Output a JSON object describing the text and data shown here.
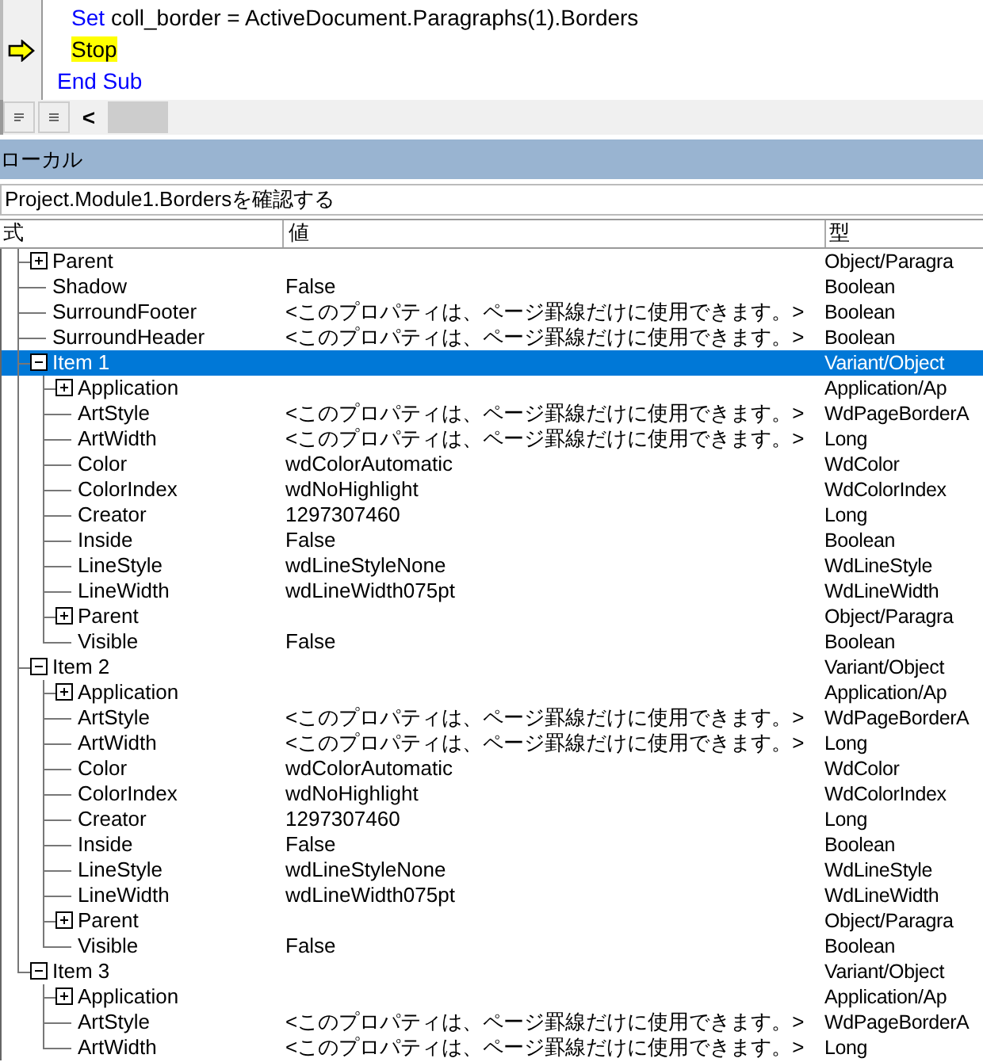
{
  "code": {
    "body_lines": [
      {
        "current": false,
        "tokens": [
          {
            "kind": "keyword",
            "text": "Set"
          },
          {
            "kind": "plain",
            "text": "coll_border = ActiveDocument.Paragraphs(1).Borders"
          }
        ]
      },
      {
        "current": true,
        "tokens": [
          {
            "kind": "plain",
            "text": "Stop"
          }
        ]
      }
    ],
    "end_line": {
      "current": false,
      "tokens": [
        {
          "kind": "keyword",
          "text": "End Sub"
        }
      ]
    }
  },
  "scroll_left": "<",
  "panel": {
    "title": "ローカル",
    "context": "Project.Module1.Bordersを確認する"
  },
  "columns": [
    "式",
    "値",
    "型"
  ],
  "tree": [
    {
      "name": "Parent",
      "type": "Object/Paragra",
      "expanded": false,
      "selected": false
    },
    {
      "name": "Shadow",
      "value": "False",
      "type": "Boolean",
      "selected": false
    },
    {
      "name": "SurroundFooter",
      "value": "<このプロパティは、ページ罫線だけに使用できます。>",
      "type": "Boolean",
      "selected": false
    },
    {
      "name": "SurroundHeader",
      "value": "<このプロパティは、ページ罫線だけに使用できます。>",
      "type": "Boolean",
      "selected": false
    },
    {
      "name": "Item 1",
      "type": "Variant/Object",
      "expanded": true,
      "selected": true,
      "children": [
        {
          "name": "Application",
          "type": "Application/Ap",
          "expanded": false,
          "selected": false
        },
        {
          "name": "ArtStyle",
          "value": "<このプロパティは、ページ罫線だけに使用できます。>",
          "type": "WdPageBorderA",
          "selected": false
        },
        {
          "name": "ArtWidth",
          "value": "<このプロパティは、ページ罫線だけに使用できます。>",
          "type": "Long",
          "selected": false
        },
        {
          "name": "Color",
          "value": "wdColorAutomatic",
          "type": "WdColor",
          "selected": false
        },
        {
          "name": "ColorIndex",
          "value": "wdNoHighlight",
          "type": "WdColorIndex",
          "selected": false
        },
        {
          "name": "Creator",
          "value": "1297307460",
          "type": "Long",
          "selected": false
        },
        {
          "name": "Inside",
          "value": "False",
          "type": "Boolean",
          "selected": false
        },
        {
          "name": "LineStyle",
          "value": "wdLineStyleNone",
          "type": "WdLineStyle",
          "selected": false
        },
        {
          "name": "LineWidth",
          "value": "wdLineWidth075pt",
          "type": "WdLineWidth",
          "selected": false
        },
        {
          "name": "Parent",
          "type": "Object/Paragra",
          "expanded": false,
          "selected": false
        },
        {
          "name": "Visible",
          "value": "False",
          "type": "Boolean",
          "selected": false
        }
      ]
    },
    {
      "name": "Item 2",
      "type": "Variant/Object",
      "expanded": true,
      "selected": false,
      "children": [
        {
          "name": "Application",
          "type": "Application/Ap",
          "expanded": false,
          "selected": false
        },
        {
          "name": "ArtStyle",
          "value": "<このプロパティは、ページ罫線だけに使用できます。>",
          "type": "WdPageBorderA",
          "selected": false
        },
        {
          "name": "ArtWidth",
          "value": "<このプロパティは、ページ罫線だけに使用できます。>",
          "type": "Long",
          "selected": false
        },
        {
          "name": "Color",
          "value": "wdColorAutomatic",
          "type": "WdColor",
          "selected": false
        },
        {
          "name": "ColorIndex",
          "value": "wdNoHighlight",
          "type": "WdColorIndex",
          "selected": false
        },
        {
          "name": "Creator",
          "value": "1297307460",
          "type": "Long",
          "selected": false
        },
        {
          "name": "Inside",
          "value": "False",
          "type": "Boolean",
          "selected": false
        },
        {
          "name": "LineStyle",
          "value": "wdLineStyleNone",
          "type": "WdLineStyle",
          "selected": false
        },
        {
          "name": "LineWidth",
          "value": "wdLineWidth075pt",
          "type": "WdLineWidth",
          "selected": false
        },
        {
          "name": "Parent",
          "type": "Object/Paragra",
          "expanded": false,
          "selected": false
        },
        {
          "name": "Visible",
          "value": "False",
          "type": "Boolean",
          "selected": false
        }
      ]
    },
    {
      "name": "Item 3",
      "type": "Variant/Object",
      "expanded": true,
      "selected": false,
      "children": [
        {
          "name": "Application",
          "type": "Application/Ap",
          "expanded": false,
          "selected": false
        },
        {
          "name": "ArtStyle",
          "value": "<このプロパティは、ページ罫線だけに使用できます。>",
          "type": "WdPageBorderA",
          "selected": false
        },
        {
          "name": "ArtWidth",
          "value": "<このプロパティは、ページ罫線だけに使用できます。>",
          "type": "Long",
          "selected": false
        }
      ]
    }
  ]
}
